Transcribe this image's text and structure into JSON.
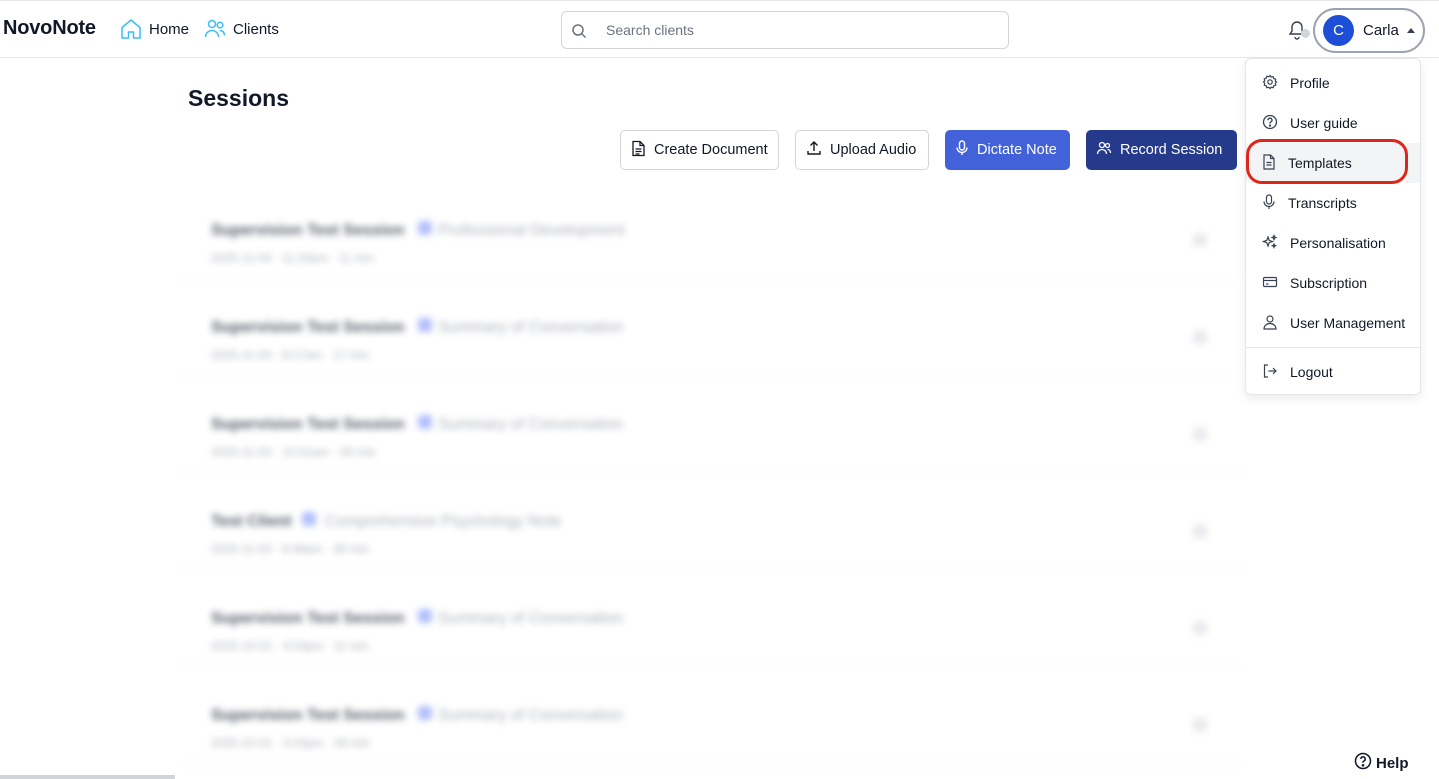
{
  "topbar": {
    "brand": "NovoNote",
    "nav": [
      {
        "label": "Home",
        "icon": "home-icon"
      },
      {
        "label": "Clients",
        "icon": "users-icon"
      }
    ],
    "search": {
      "placeholder": "Search clients",
      "value": ""
    },
    "user": {
      "initial": "C",
      "name": "Carla",
      "avatar_color": "#1d4ed8"
    }
  },
  "main": {
    "title": "Sessions",
    "actions": {
      "create_document": "Create Document",
      "upload_audio": "Upload Audio",
      "dictate_note": "Dictate Note",
      "record_session": "Record Session"
    },
    "sessions": [
      {
        "title": "Supervision Test Session",
        "subtitle": "Professional Development",
        "meta": "2025-11-04  ·  11:33am  ·  11 min"
      },
      {
        "title": "Supervision Test Session",
        "subtitle": "Summary of Conversation",
        "meta": "2025-11-04  ·  9:17am  ·  17 min"
      },
      {
        "title": "Supervision Test Session",
        "subtitle": "Summary of Conversation",
        "meta": "2025-11-03  ·  10:41am  ·  28 min"
      },
      {
        "title": "Test Client",
        "subtitle": "Comprehensive Psychology Note",
        "meta": "2025-11-03  ·  9:48am  ·  39 min"
      },
      {
        "title": "Supervision Test Session",
        "subtitle": "Summary of Conversation",
        "meta": "2025-10-31  ·  4:03pm  ·  11 min"
      },
      {
        "title": "Supervision Test Session",
        "subtitle": "Summary of Conversation",
        "meta": "2025-10-31  ·  3:15pm  ·  28 min"
      }
    ]
  },
  "dropdown": {
    "items": [
      {
        "label": "Profile",
        "icon": "gear-icon"
      },
      {
        "label": "User guide",
        "icon": "question-circle-icon"
      },
      {
        "label": "Templates",
        "icon": "document-icon",
        "active": true
      },
      {
        "label": "Transcripts",
        "icon": "microphone-icon"
      },
      {
        "label": "Personalisation",
        "icon": "sparkles-icon"
      },
      {
        "label": "Subscription",
        "icon": "credit-card-icon"
      },
      {
        "label": "User Management",
        "icon": "user-icon"
      }
    ],
    "logout": {
      "label": "Logout",
      "icon": "logout-icon"
    },
    "highlight_color": "#e0261b"
  },
  "help": {
    "label": "Help",
    "icon": "question-circle-icon"
  },
  "colors": {
    "dictate_button": "#4361d8",
    "record_button": "#263a8c",
    "accent": "#1d4ed8"
  }
}
